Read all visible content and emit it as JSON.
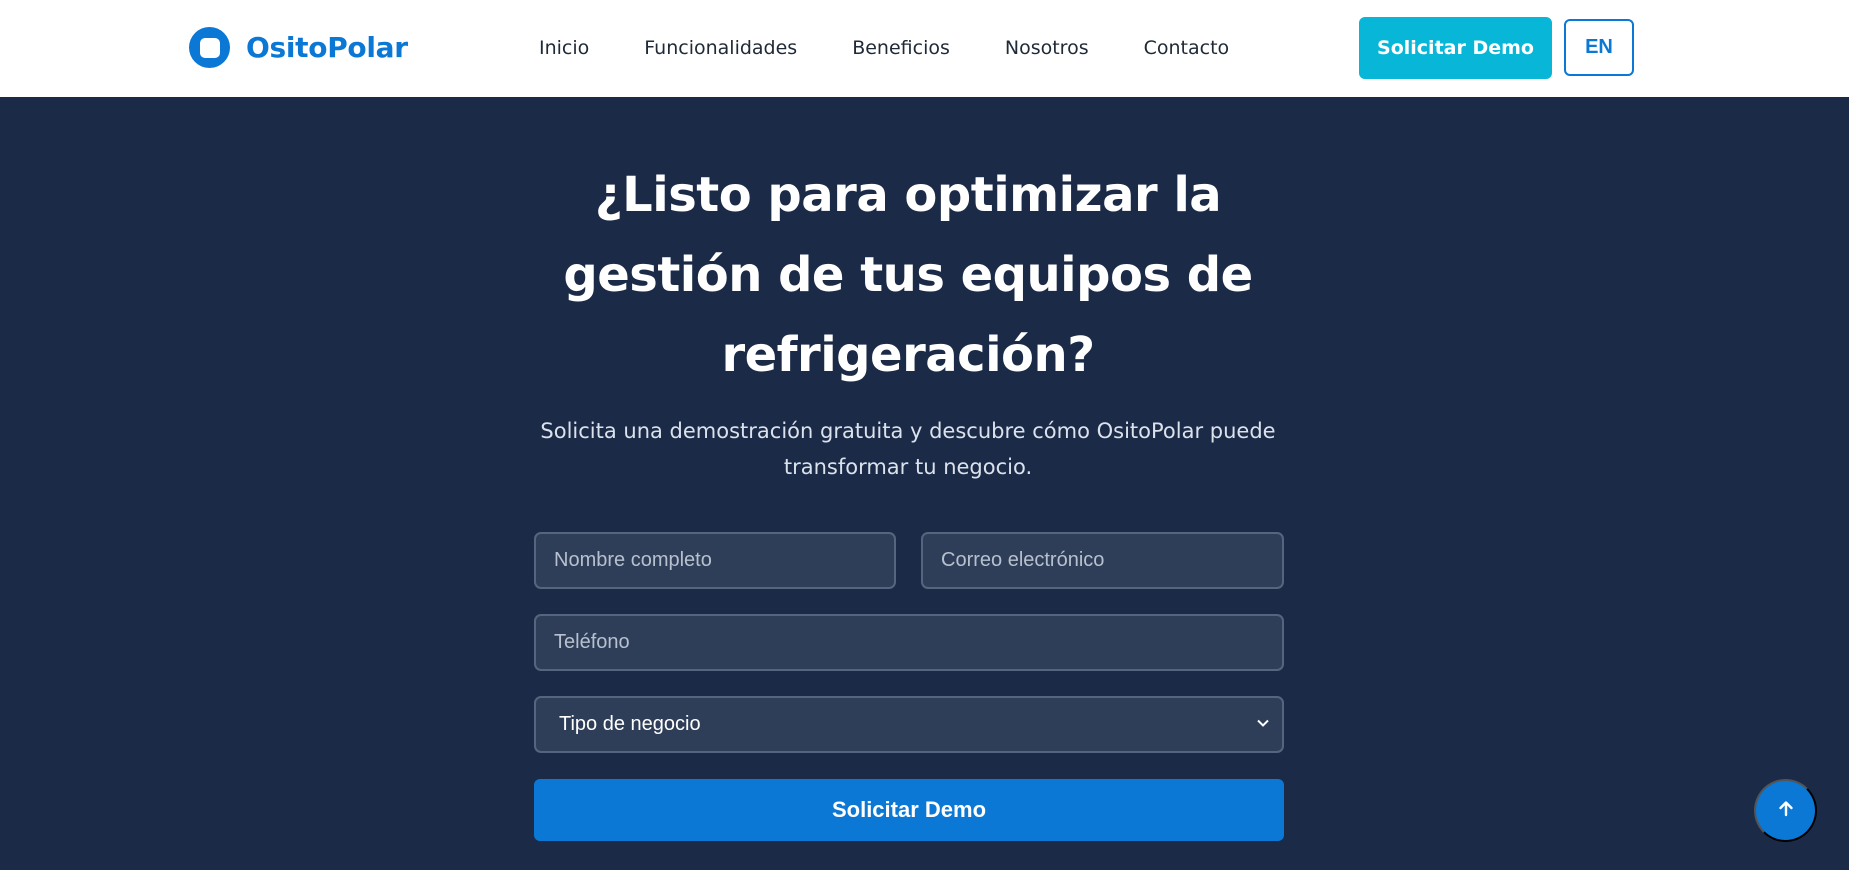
{
  "nav": {
    "brand": "OsitoPolar",
    "links": [
      "Inicio",
      "Funcionalidades",
      "Beneficios",
      "Nosotros",
      "Contacto"
    ],
    "demo_label": "Solicitar Demo",
    "lang_label": "EN"
  },
  "hero": {
    "title": "¿Listo para optimizar la gestión de tus equipos de refrigeración?",
    "subtitle": "Solicita una demostración gratuita y descubre cómo OsitoPolar puede transformar tu negocio."
  },
  "form": {
    "name_placeholder": "Nombre completo",
    "email_placeholder": "Correo electrónico",
    "phone_placeholder": "Teléfono",
    "business_type_selected": "Tipo de negocio",
    "submit_label": "Solicitar Demo"
  },
  "icons": {
    "logo": "snowflake-logo-icon",
    "chevron": "chevron-down-icon",
    "scroll_top": "arrow-up-icon"
  },
  "colors": {
    "brand_blue": "#0a78d4",
    "accent_cyan": "#08b6d8",
    "hero_bg": "#1b2a47",
    "field_bg": "#2f3e58"
  }
}
